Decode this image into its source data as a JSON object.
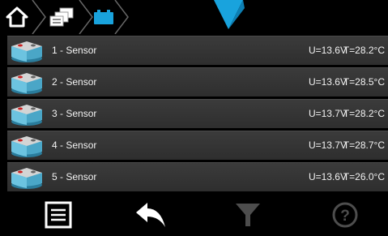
{
  "sensors": [
    {
      "name": "1 - Sensor",
      "voltage": "U=13.6V",
      "temperature": "T=28.2°C"
    },
    {
      "name": "2 - Sensor",
      "voltage": "U=13.6V",
      "temperature": "T=28.5°C"
    },
    {
      "name": "3 - Sensor",
      "voltage": "U=13.7V",
      "temperature": "T=28.2°C"
    },
    {
      "name": "4 - Sensor",
      "voltage": "U=13.7V",
      "temperature": "T=28.7°C"
    },
    {
      "name": "5 - Sensor",
      "voltage": "U=13.6V",
      "temperature": "T=26.0°C"
    }
  ],
  "icons": {
    "home": "home-icon",
    "devices": "devices-icon",
    "battery": "battery-icon",
    "menu": "menu-list-icon",
    "back": "back-arrow-icon",
    "filter": "filter-icon",
    "help": "help-icon"
  },
  "colors": {
    "accent": "#19a3dd",
    "row_bg": "#353535",
    "battery_top": "#c9c9c9",
    "battery_body": "#4aa6c7",
    "disabled": "#4d4d4d"
  }
}
